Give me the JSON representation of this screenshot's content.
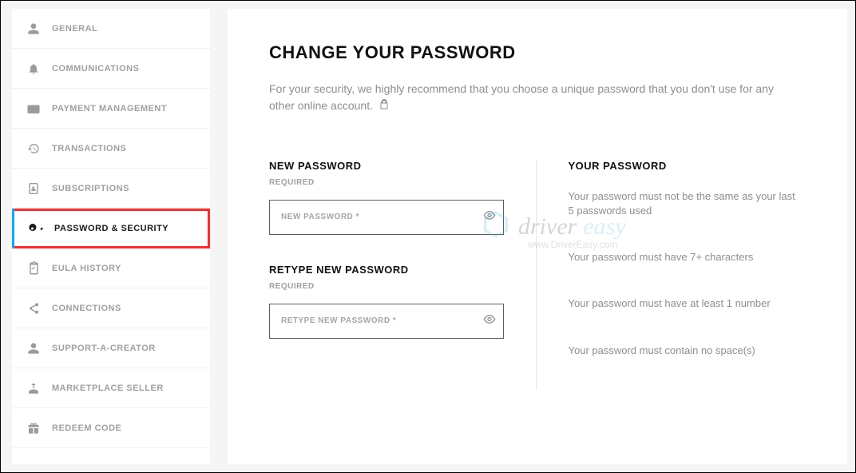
{
  "sidebar": {
    "items": [
      {
        "label": "GENERAL",
        "icon": "person-icon"
      },
      {
        "label": "COMMUNICATIONS",
        "icon": "bell-icon"
      },
      {
        "label": "PAYMENT MANAGEMENT",
        "icon": "wallet-icon"
      },
      {
        "label": "TRANSACTIONS",
        "icon": "history-icon"
      },
      {
        "label": "SUBSCRIPTIONS",
        "icon": "receipt-icon"
      },
      {
        "label": "PASSWORD & SECURITY",
        "icon": "key-icon"
      },
      {
        "label": "EULA HISTORY",
        "icon": "clipboard-icon"
      },
      {
        "label": "CONNECTIONS",
        "icon": "share-icon"
      },
      {
        "label": "SUPPORT-A-CREATOR",
        "icon": "person-icon"
      },
      {
        "label": "MARKETPLACE SELLER",
        "icon": "seller-icon"
      },
      {
        "label": "REDEEM CODE",
        "icon": "gift-icon"
      }
    ],
    "active_index": 5
  },
  "page": {
    "title": "CHANGE YOUR PASSWORD",
    "subtitle": "For your security, we highly recommend that you choose a unique password that you don't use for any other online account."
  },
  "form": {
    "new_password": {
      "label": "NEW PASSWORD",
      "required_text": "REQUIRED",
      "placeholder": "NEW PASSWORD *",
      "value": ""
    },
    "retype_password": {
      "label": "RETYPE NEW PASSWORD",
      "required_text": "REQUIRED",
      "placeholder": "RETYPE NEW PASSWORD *",
      "value": ""
    }
  },
  "requirements": {
    "heading": "YOUR PASSWORD",
    "items": [
      "Your password must not be the same as your last 5 passwords used",
      "Your password must have 7+ characters",
      "Your password must have at least 1 number",
      "Your password must contain no space(s)"
    ]
  },
  "watermark": {
    "text1": "driver",
    "text2": "easy",
    "url": "www.DriverEasy.com"
  }
}
